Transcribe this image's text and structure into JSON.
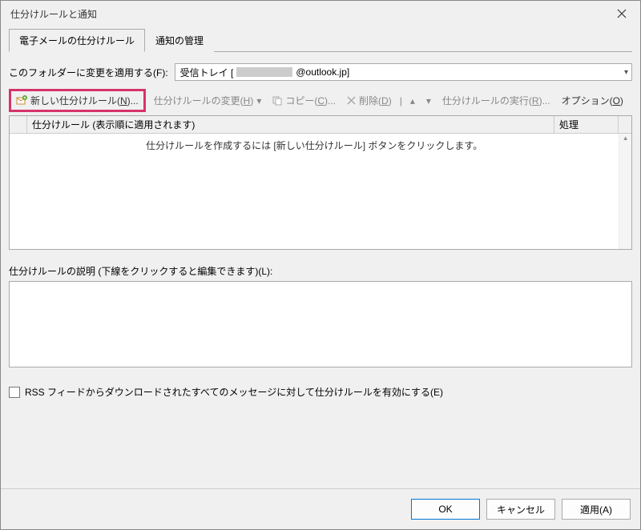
{
  "title": "仕分けルールと通知",
  "tabs": {
    "email_rules": "電子メールの仕分けルール",
    "notifications": "通知の管理"
  },
  "folder": {
    "label": "このフォルダーに変更を適用する(F):",
    "value_prefix": "受信トレイ [",
    "value_suffix": "@outlook.jp]"
  },
  "toolbar": {
    "new_rule": "新しい仕分けルール(N)...",
    "change_rule": "仕分けルールの変更(H)",
    "copy": "コピー(C)...",
    "delete": "削除(D)",
    "run": "仕分けルールの実行(R)...",
    "options": "オプション(O)"
  },
  "table": {
    "col_rule": "仕分けルール (表示順に適用されます)",
    "col_action": "処理",
    "empty_msg": "仕分けルールを作成するには [新しい仕分けルール] ボタンをクリックします。"
  },
  "description_label": "仕分けルールの説明 (下線をクリックすると編集できます)(L):",
  "rss_label": "RSS フィードからダウンロードされたすべてのメッセージに対して仕分けルールを有効にする(E)",
  "buttons": {
    "ok": "OK",
    "cancel": "キャンセル",
    "apply": "適用(A)"
  }
}
